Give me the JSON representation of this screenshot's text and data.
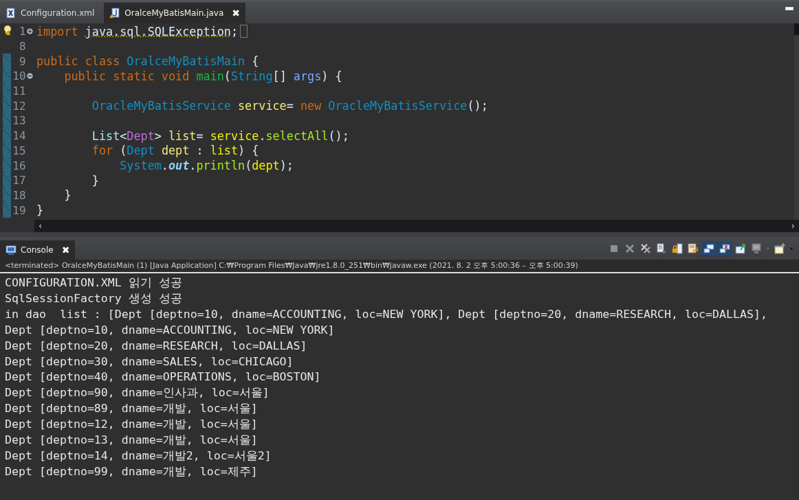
{
  "editor_tabs": [
    {
      "label": "Configuration.xml",
      "kind": "xml",
      "selected": false
    },
    {
      "label": "OralceMyBatisMain.java",
      "kind": "java",
      "selected": true
    }
  ],
  "close_glyph": "✖",
  "editor": {
    "lines": [
      {
        "number": "1",
        "fold_expanded": false,
        "warning": true,
        "changed": false,
        "folded_marker": true,
        "tokens": [
          {
            "text": "import ",
            "kind": "keyword"
          },
          {
            "text": "java.sql.SQLException",
            "kind": "warned"
          },
          {
            "text": ";",
            "kind": "plain"
          }
        ]
      },
      {
        "number": "8",
        "changed": false
      },
      {
        "number": "9",
        "changed": true,
        "tokens": [
          {
            "text": "public class ",
            "kind": "keyword"
          },
          {
            "text": "OralceMyBatisMain",
            "kind": "type"
          },
          {
            "text": " {",
            "kind": "plain"
          }
        ]
      },
      {
        "number": "10",
        "fold_expanded": true,
        "changed": true,
        "tokens": [
          {
            "text": "    public static void ",
            "kind": "keyword"
          },
          {
            "text": "main",
            "kind": "declaration"
          },
          {
            "text": "(",
            "kind": "plain"
          },
          {
            "text": "String",
            "kind": "type"
          },
          {
            "text": "[] ",
            "kind": "plain"
          },
          {
            "text": "args",
            "kind": "param"
          },
          {
            "text": ") {",
            "kind": "plain"
          }
        ]
      },
      {
        "number": "11",
        "changed": true
      },
      {
        "number": "12",
        "changed": true,
        "tokens": [
          {
            "text": "        OracleMyBatisService",
            "kind": "type"
          },
          {
            "text": " service",
            "kind": "local"
          },
          {
            "text": "= ",
            "kind": "plain"
          },
          {
            "text": "new ",
            "kind": "keyword"
          },
          {
            "text": "OracleMyBatisService",
            "kind": "type"
          },
          {
            "text": "();",
            "kind": "plain"
          }
        ]
      },
      {
        "number": "13",
        "changed": true
      },
      {
        "number": "14",
        "changed": true,
        "tokens": [
          {
            "text": "        List",
            "kind": "interface"
          },
          {
            "text": "<",
            "kind": "plain"
          },
          {
            "text": "Dept",
            "kind": "typearg"
          },
          {
            "text": "> ",
            "kind": "plain"
          },
          {
            "text": "list",
            "kind": "local"
          },
          {
            "text": "= ",
            "kind": "plain"
          },
          {
            "text": "service",
            "kind": "localref"
          },
          {
            "text": ".",
            "kind": "plain"
          },
          {
            "text": "selectAll",
            "kind": "method"
          },
          {
            "text": "();",
            "kind": "plain"
          }
        ]
      },
      {
        "number": "15",
        "changed": true,
        "tokens": [
          {
            "text": "        for",
            "kind": "keyword"
          },
          {
            "text": " (",
            "kind": "plain"
          },
          {
            "text": "Dept",
            "kind": "type"
          },
          {
            "text": " dept",
            "kind": "local"
          },
          {
            "text": " : ",
            "kind": "plain"
          },
          {
            "text": "list",
            "kind": "localref"
          },
          {
            "text": ") {",
            "kind": "plain"
          }
        ]
      },
      {
        "number": "16",
        "changed": true,
        "tokens": [
          {
            "text": "            System",
            "kind": "type"
          },
          {
            "text": ".",
            "kind": "plain"
          },
          {
            "text": "out",
            "kind": "field"
          },
          {
            "text": ".",
            "kind": "plain"
          },
          {
            "text": "println",
            "kind": "method"
          },
          {
            "text": "(",
            "kind": "plain"
          },
          {
            "text": "dept",
            "kind": "localref"
          },
          {
            "text": ");",
            "kind": "plain"
          }
        ]
      },
      {
        "number": "17",
        "changed": true,
        "tokens": [
          {
            "text": "        }",
            "kind": "plain"
          }
        ]
      },
      {
        "number": "18",
        "changed": true,
        "tokens": [
          {
            "text": "    }",
            "kind": "plain"
          }
        ]
      },
      {
        "number": "19",
        "changed": true,
        "tokens": [
          {
            "text": "}",
            "kind": "plain"
          }
        ]
      }
    ],
    "scroll_left": "‹",
    "scroll_right": "›"
  },
  "console": {
    "tab": {
      "label": "Console",
      "selected": true
    },
    "toolbar": [
      {
        "kind": "terminate",
        "disabled": true,
        "selected": false
      },
      {
        "kind": "remove",
        "disabled": true,
        "selected": false
      },
      {
        "kind": "remove-all",
        "disabled": false,
        "selected": false
      },
      {
        "kind": "clear",
        "disabled": false,
        "selected": false
      },
      {
        "kind": "scroll-lock",
        "disabled": false,
        "selected": false
      },
      {
        "kind": "word-wrap",
        "disabled": false,
        "selected": false
      },
      {
        "kind": "show-stdout",
        "disabled": false,
        "selected": true
      },
      {
        "kind": "show-stderr",
        "disabled": false,
        "selected": true
      },
      {
        "kind": "pin",
        "disabled": false,
        "selected": false
      },
      {
        "kind": "display",
        "disabled": true,
        "selected": false
      },
      {
        "kind": "new-console",
        "disabled": false,
        "selected": false
      }
    ],
    "description": "<terminated> OralceMyBatisMain (1) [Java Application] C:₩Program Files₩Java₩jre1.8.0_251₩bin₩javaw.exe  (2021. 8. 2 오후 5:00:36 – 오후 5:00:39)",
    "output": [
      "CONFIGURATION.XML 읽기 성공",
      "SqlSessionFactory 생성 성공",
      "in dao  list : [Dept [deptno=10, dname=ACCOUNTING, loc=NEW YORK], Dept [deptno=20, dname=RESEARCH, loc=DALLAS],",
      "Dept [deptno=10, dname=ACCOUNTING, loc=NEW YORK]",
      "Dept [deptno=20, dname=RESEARCH, loc=DALLAS]",
      "Dept [deptno=30, dname=SALES, loc=CHICAGO]",
      "Dept [deptno=40, dname=OPERATIONS, loc=BOSTON]",
      "Dept [deptno=90, dname=인사과, loc=서울]",
      "Dept [deptno=89, dname=개발, loc=서울]",
      "Dept [deptno=12, dname=개발, loc=서울]",
      "Dept [deptno=13, dname=개발, loc=서울]",
      "Dept [deptno=14, dname=개발2, loc=서울2]",
      "Dept [deptno=99, dname=개발, loc=제주]"
    ]
  }
}
